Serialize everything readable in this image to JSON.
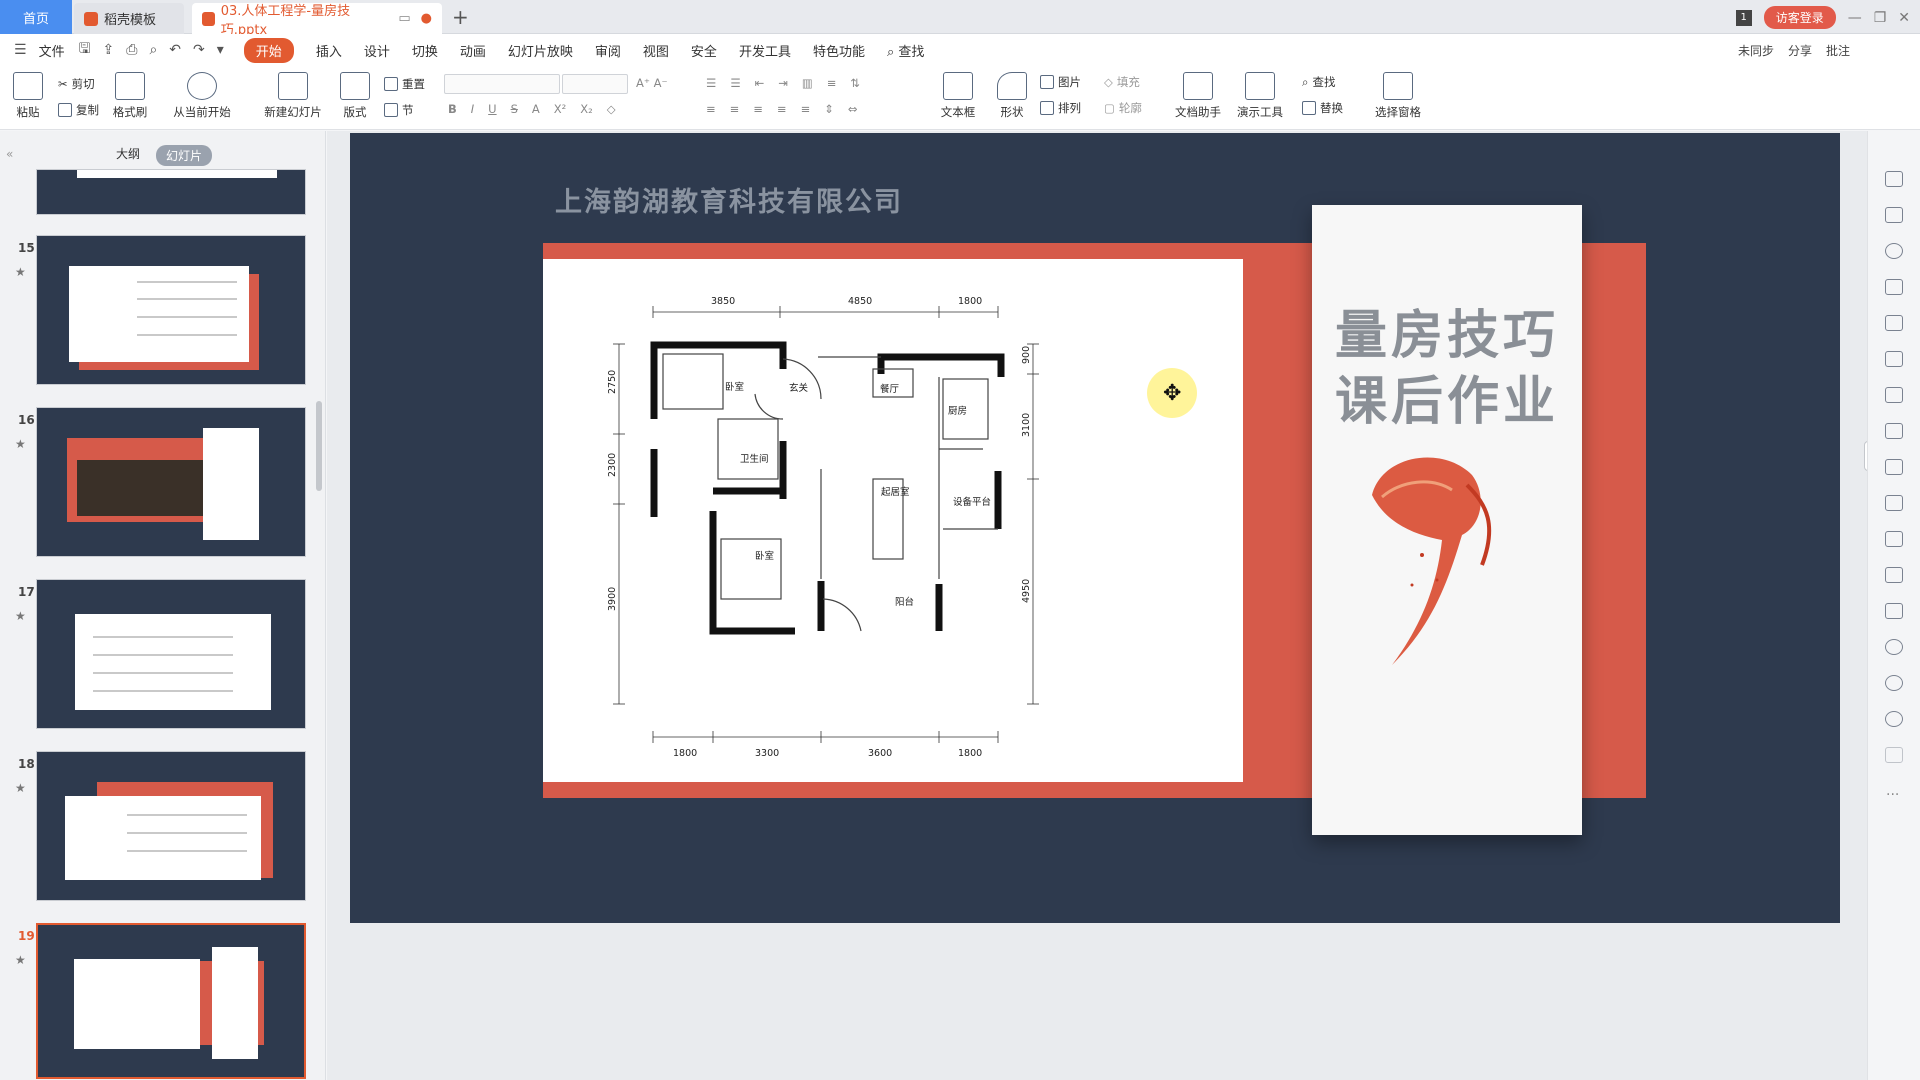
{
  "titlebar": {
    "home_tab": "首页",
    "template_tab": "稻壳模板",
    "doc_tab": "03.人体工程学-量房技巧.pptx",
    "badge": "1",
    "login": "访客登录"
  },
  "menu": {
    "file": "文件",
    "items": [
      "开始",
      "插入",
      "设计",
      "切换",
      "动画",
      "幻灯片放映",
      "审阅",
      "视图",
      "安全",
      "开发工具",
      "特色功能"
    ],
    "search": "查找",
    "right": [
      "未同步",
      "分享",
      "批注"
    ]
  },
  "ribbon": {
    "paste": "粘贴",
    "cut": "剪切",
    "copy": "复制",
    "format_painter": "格式刷",
    "play_from_current": "从当前开始",
    "new_slide": "新建幻灯片",
    "layout": "版式",
    "reset": "重置",
    "section": "节",
    "textbox": "文本框",
    "shape": "形状",
    "picture": "图片",
    "fill": "填充",
    "arrange": "排列",
    "outline": "轮廓",
    "doc_assistant": "文档助手",
    "present_tools": "演示工具",
    "find": "查找",
    "replace": "替换",
    "select_pane": "选择窗格"
  },
  "left_panel": {
    "tab_outline": "大纲",
    "tab_slides": "幻灯片",
    "thumbnails": [
      {
        "num": "15"
      },
      {
        "num": "16"
      },
      {
        "num": "17"
      },
      {
        "num": "18"
      },
      {
        "num": "19"
      }
    ]
  },
  "slide": {
    "company": "上海韵湖教育科技有限公司",
    "card_line1": "量房技巧",
    "card_line2": "课后作业",
    "plan": {
      "top_dims": [
        "3850",
        "4850",
        "1800"
      ],
      "bottom_dims": [
        "1800",
        "3300",
        "3600",
        "1800"
      ],
      "left_dims": [
        "2750",
        "2300",
        "3900"
      ],
      "right_dims": [
        "900",
        "3100",
        "4950"
      ],
      "rooms": [
        "卧室",
        "玄关",
        "餐厅",
        "厨房",
        "卫生间",
        "起居室",
        "设备平台",
        "卧室",
        "阳台"
      ]
    }
  },
  "colors": {
    "accent": "#e25a30",
    "slide_bg": "#2e3a4e",
    "slide_red": "#d65a4a"
  }
}
